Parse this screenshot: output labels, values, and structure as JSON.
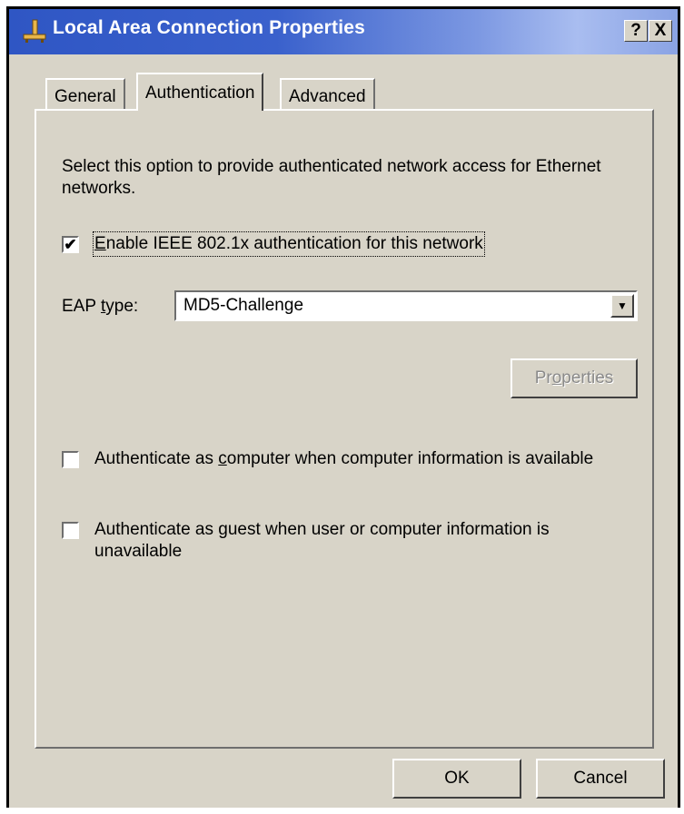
{
  "window": {
    "title": "Local Area Connection Properties",
    "help_label": "?",
    "close_label": "X"
  },
  "tabs": [
    {
      "label": "General",
      "active": false
    },
    {
      "label": "Authentication",
      "active": true
    },
    {
      "label": "Advanced",
      "active": false
    }
  ],
  "authentication": {
    "description": "Select this option to provide authenticated network access for Ethernet networks.",
    "enable_8021x": {
      "label_prefix": "",
      "accel": "E",
      "label_rest": "nable IEEE 802.1x authentication for this network",
      "checked": true
    },
    "eap_type": {
      "label_prefix": "EAP ",
      "accel": "t",
      "label_rest": "ype:",
      "value": "MD5-Challenge"
    },
    "properties_button": {
      "label_prefix": "Pr",
      "accel": "o",
      "label_rest": "perties",
      "enabled": false
    },
    "auth_as_computer": {
      "label_prefix": "Authenticate as ",
      "accel": "c",
      "label_rest": "omputer when computer information is available",
      "checked": false
    },
    "auth_as_guest": {
      "label_prefix": "Authenticate as ",
      "accel": "g",
      "label_rest": "uest when user or computer information is unavailable",
      "checked": false
    }
  },
  "footer": {
    "ok_label": "OK",
    "cancel_label": "Cancel"
  },
  "colors": {
    "titlebar_start": "#2f56c4",
    "dialog_face": "#d8d4c8",
    "disabled_text": "#8a8a8a"
  }
}
